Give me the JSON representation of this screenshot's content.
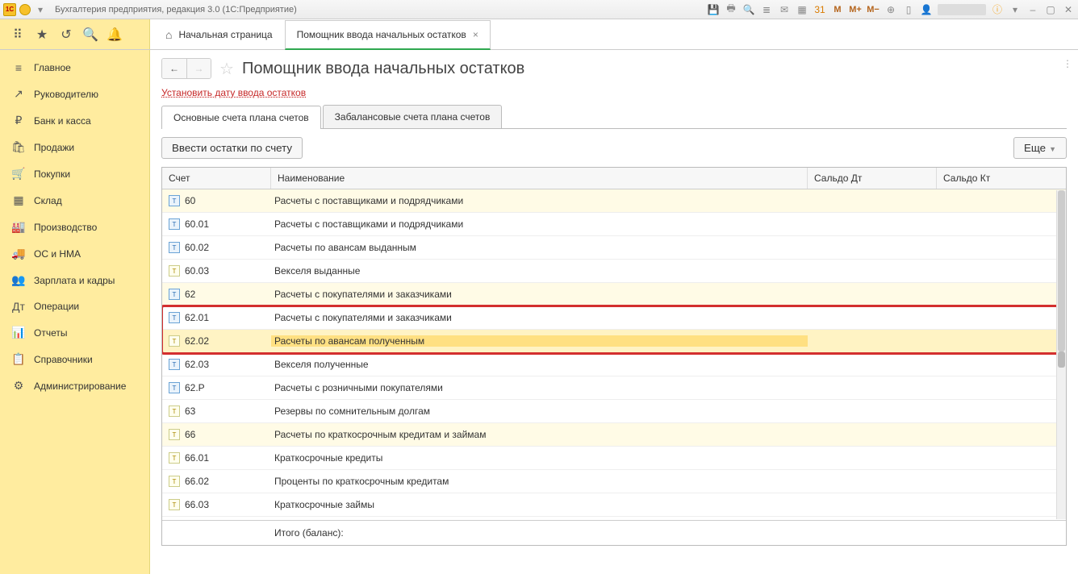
{
  "topbar": {
    "title": "Бухгалтерия предприятия, редакция 3.0  (1С:Предприятие)"
  },
  "tabs": {
    "home": "Начальная страница",
    "current": "Помощник ввода начальных остатков"
  },
  "sidebar": {
    "items": [
      {
        "icon": "≡",
        "label": "Главное"
      },
      {
        "icon": "↗",
        "label": "Руководителю"
      },
      {
        "icon": "₽",
        "label": "Банк и касса"
      },
      {
        "icon": "🛍",
        "label": "Продажи"
      },
      {
        "icon": "🛒",
        "label": "Покупки"
      },
      {
        "icon": "▦",
        "label": "Склад"
      },
      {
        "icon": "🏭",
        "label": "Производство"
      },
      {
        "icon": "🚚",
        "label": "ОС и НМА"
      },
      {
        "icon": "👥",
        "label": "Зарплата и кадры"
      },
      {
        "icon": "Дт",
        "label": "Операции"
      },
      {
        "icon": "📊",
        "label": "Отчеты"
      },
      {
        "icon": "📋",
        "label": "Справочники"
      },
      {
        "icon": "⚙",
        "label": "Администрирование"
      }
    ]
  },
  "page": {
    "title": "Помощник ввода начальных остатков",
    "setDateLink": "Установить дату ввода остатков",
    "tab1": "Основные счета плана счетов",
    "tab2": "Забалансовые счета плана счетов",
    "enterBtn": "Ввести остатки по счету",
    "moreBtn": "Еще"
  },
  "grid": {
    "headers": {
      "acct": "Счет",
      "name": "Наименование",
      "dt": "Сальдо Дт",
      "kt": "Сальдо Кт"
    },
    "rows": [
      {
        "acct": "60",
        "name": "Расчеты с поставщиками и подрядчиками",
        "group": true,
        "blue": true
      },
      {
        "acct": "60.01",
        "name": "Расчеты с поставщиками и подрядчиками",
        "blue": true
      },
      {
        "acct": "60.02",
        "name": "Расчеты по авансам выданным",
        "blue": true
      },
      {
        "acct": "60.03",
        "name": "Векселя выданные"
      },
      {
        "acct": "62",
        "name": "Расчеты с покупателями и заказчиками",
        "group": true,
        "blue": true
      },
      {
        "acct": "62.01",
        "name": "Расчеты с покупателями и заказчиками",
        "blue": true,
        "hl": true
      },
      {
        "acct": "62.02",
        "name": "Расчеты по авансам полученным",
        "selected": true,
        "hl": true
      },
      {
        "acct": "62.03",
        "name": "Векселя полученные",
        "blue": true
      },
      {
        "acct": "62.Р",
        "name": "Расчеты с розничными покупателями",
        "blue": true
      },
      {
        "acct": "63",
        "name": "Резервы по сомнительным долгам"
      },
      {
        "acct": "66",
        "name": "Расчеты по краткосрочным кредитам и займам",
        "group": true
      },
      {
        "acct": "66.01",
        "name": "Краткосрочные кредиты"
      },
      {
        "acct": "66.02",
        "name": "Проценты по краткосрочным кредитам"
      },
      {
        "acct": "66.03",
        "name": "Краткосрочные займы"
      }
    ],
    "footer": "Итого (баланс):"
  }
}
